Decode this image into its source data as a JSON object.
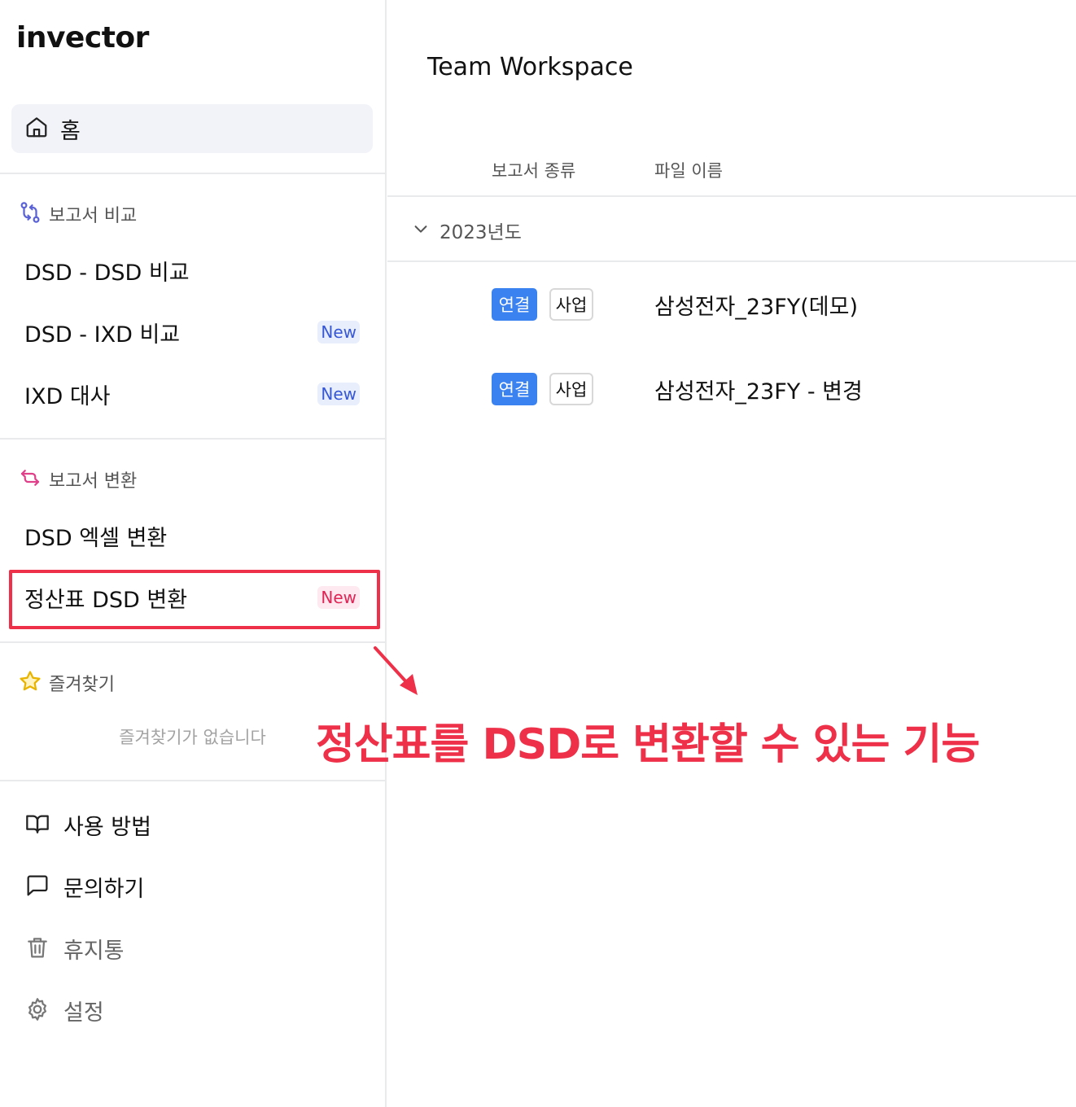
{
  "app": {
    "logo": "invector"
  },
  "sidebar": {
    "home_label": "홈",
    "compare": {
      "heading": "보고서 비교",
      "items": [
        {
          "label": "DSD - DSD 비교",
          "badge": ""
        },
        {
          "label": "DSD - IXD 비교",
          "badge": "New"
        },
        {
          "label": "IXD 대사",
          "badge": "New"
        }
      ]
    },
    "convert": {
      "heading": "보고서 변환",
      "items": [
        {
          "label": "DSD 엑셀 변환",
          "badge": ""
        },
        {
          "label": "정산표 DSD 변환",
          "badge": "New"
        }
      ]
    },
    "favorites": {
      "heading": "즐겨찾기",
      "empty_text": "즐겨찾기가 없습니다"
    },
    "bottom": [
      {
        "label": "사용 방법",
        "icon": "book-icon"
      },
      {
        "label": "문의하기",
        "icon": "message-icon"
      },
      {
        "label": "휴지통",
        "icon": "trash-icon"
      },
      {
        "label": "설정",
        "icon": "gear-icon"
      }
    ]
  },
  "main": {
    "title": "Team Workspace",
    "columns": {
      "type": "보고서 종류",
      "name": "파일 이름"
    },
    "group": {
      "label": "2023년도"
    },
    "rows": [
      {
        "tag1": "연결",
        "tag2": "사업",
        "name": "삼성전자_23FY(데모)"
      },
      {
        "tag1": "연결",
        "tag2": "사업",
        "name": "삼성전자_23FY - 변경"
      }
    ]
  },
  "annotation": {
    "text": "정산표를 DSD로 변환할 수 있는 기능"
  },
  "colors": {
    "accent_blue": "#3a82f0",
    "highlight_red": "#ee3048",
    "new_badge_blue": "#3657d6",
    "new_badge_pink": "#e02455"
  }
}
